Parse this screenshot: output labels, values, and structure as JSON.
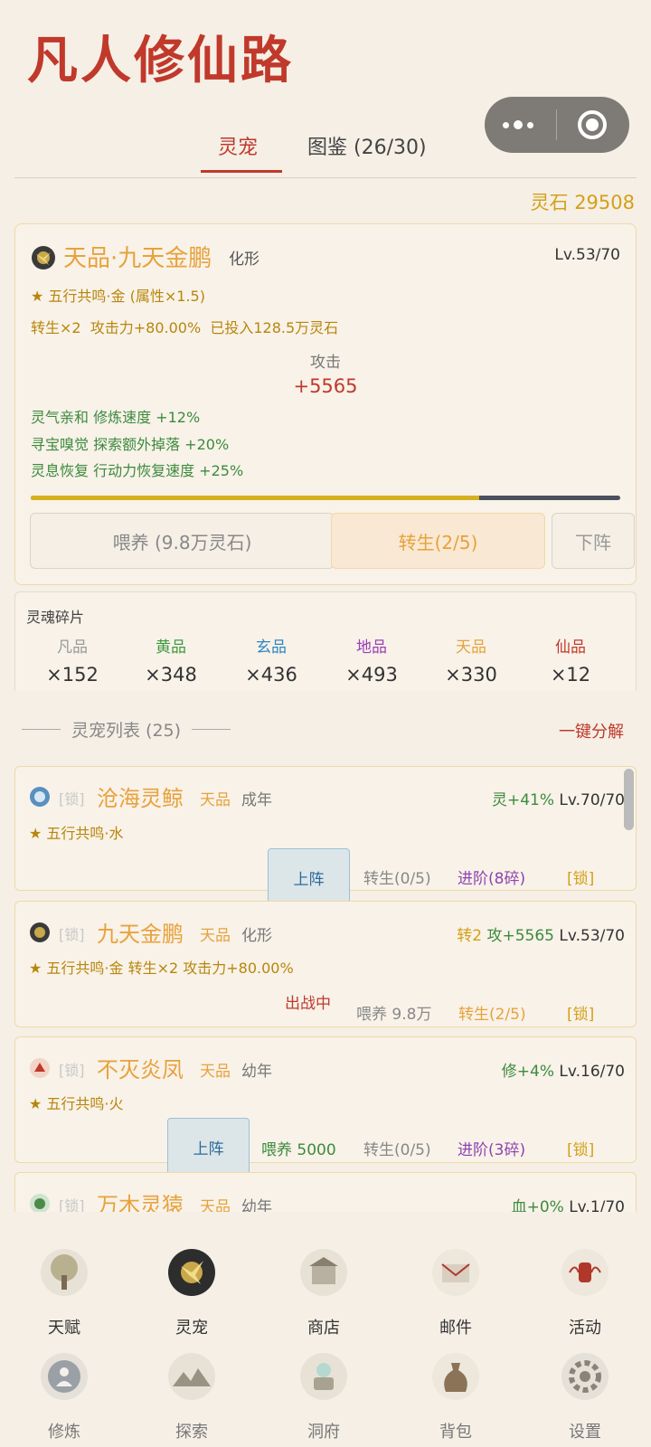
{
  "app": {
    "title": "凡人修仙路"
  },
  "tabs": [
    {
      "label": "灵宠"
    },
    {
      "label": "图鉴 (26/30)"
    }
  ],
  "resources": {
    "spirit_stones": "灵石 29508"
  },
  "active_pet": {
    "quality_name": "天品·九天金鹏",
    "form": "化形",
    "level": "Lv.53/70",
    "resonance": "★ 五行共鸣·金 (属性×1.5)",
    "stats_line": "转生×2  攻击力+80.00%  已投入128.5万灵石",
    "attack_label": "攻击",
    "attack_value": "+5565",
    "buffs": [
      "灵气亲和 修炼速度 +12%",
      "寻宝嗅觉 探索额外掉落 +20%",
      "灵息恢复 行动力恢复速度 +25%"
    ],
    "progress_fraction": 0.76,
    "buttons": {
      "feed": "喂养 (9.8万灵石)",
      "rebirth": "转生(2/5)",
      "unequip": "下阵"
    }
  },
  "soul_shards": {
    "title": "灵魂碎片",
    "grades": [
      {
        "grade": "凡品",
        "count": "×152",
        "color": "#999999"
      },
      {
        "grade": "黄品",
        "count": "×348",
        "color": "#3d9a3d"
      },
      {
        "grade": "玄品",
        "count": "×436",
        "color": "#2e86c1"
      },
      {
        "grade": "地品",
        "count": "×493",
        "color": "#9b3fb5"
      },
      {
        "grade": "天品",
        "count": "×330",
        "color": "#e8a23a"
      },
      {
        "grade": "仙品",
        "count": "×12",
        "color": "#c0392b"
      }
    ]
  },
  "pet_list": {
    "header": "灵宠列表 (25)",
    "decompose": "一键分解",
    "items": [
      {
        "lock": "[锁]",
        "name": "沧海灵鲸",
        "quality": "天品",
        "stage": "成年",
        "bonus": "灵+41%",
        "level": "Lv.70/70",
        "resonance": "★ 五行共鸣·水",
        "deploy": "上阵",
        "rebirth": "转生(0/5)",
        "advance": "进阶(8碎)",
        "lock_action": "[锁]"
      },
      {
        "lock": "[锁]",
        "name": "九天金鹏",
        "quality": "天品",
        "stage": "化形",
        "rebirth_tag": "转2",
        "attack": "攻+5565",
        "level": "Lv.53/70",
        "resonance": "★ 五行共鸣·金  转生×2 攻击力+80.00%",
        "status": "出战中",
        "feed": "喂养 9.8万",
        "rebirth": "转生(2/5)",
        "lock_action": "[锁]"
      },
      {
        "lock": "[锁]",
        "name": "不灭炎凤",
        "quality": "天品",
        "stage": "幼年",
        "bonus": "修+4%",
        "level": "Lv.16/70",
        "resonance": "★ 五行共鸣·火",
        "deploy": "上阵",
        "feed": "喂养 5000",
        "rebirth": "转生(0/5)",
        "advance": "进阶(3碎)",
        "lock_action": "[锁]"
      },
      {
        "lock": "[锁]",
        "name": "万木灵猿",
        "quality": "天品",
        "stage": "幼年",
        "bonus": "血+0%",
        "level": "Lv.1/70"
      }
    ]
  },
  "bottom_nav": [
    {
      "label": "天赋",
      "icon": "tree-icon"
    },
    {
      "label": "灵宠",
      "icon": "spirit-pet-icon"
    },
    {
      "label": "商店",
      "icon": "shop-icon"
    },
    {
      "label": "邮件",
      "icon": "mail-icon"
    },
    {
      "label": "活动",
      "icon": "event-icon"
    },
    {
      "label": "修炼",
      "icon": "cultivate-icon"
    },
    {
      "label": "探索",
      "icon": "explore-icon"
    },
    {
      "label": "洞府",
      "icon": "cave-icon"
    },
    {
      "label": "背包",
      "icon": "bag-icon"
    },
    {
      "label": "设置",
      "icon": "settings-icon"
    }
  ]
}
